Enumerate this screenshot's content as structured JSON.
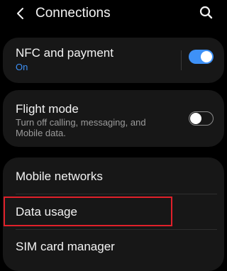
{
  "header": {
    "title": "Connections",
    "back_icon": "back-arrow-icon",
    "search_icon": "search-icon"
  },
  "nfc": {
    "title": "NFC and payment",
    "status": "On",
    "toggle_on": true
  },
  "flight": {
    "title": "Flight mode",
    "description": "Turn off calling, messaging, and Mobile data.",
    "toggle_on": false
  },
  "menu": {
    "items": [
      {
        "label": "Mobile networks"
      },
      {
        "label": "Data usage"
      },
      {
        "label": "SIM card manager"
      }
    ]
  },
  "colors": {
    "background": "#000000",
    "card": "#171717",
    "accent": "#3e91f7",
    "highlight": "#e0202a"
  }
}
